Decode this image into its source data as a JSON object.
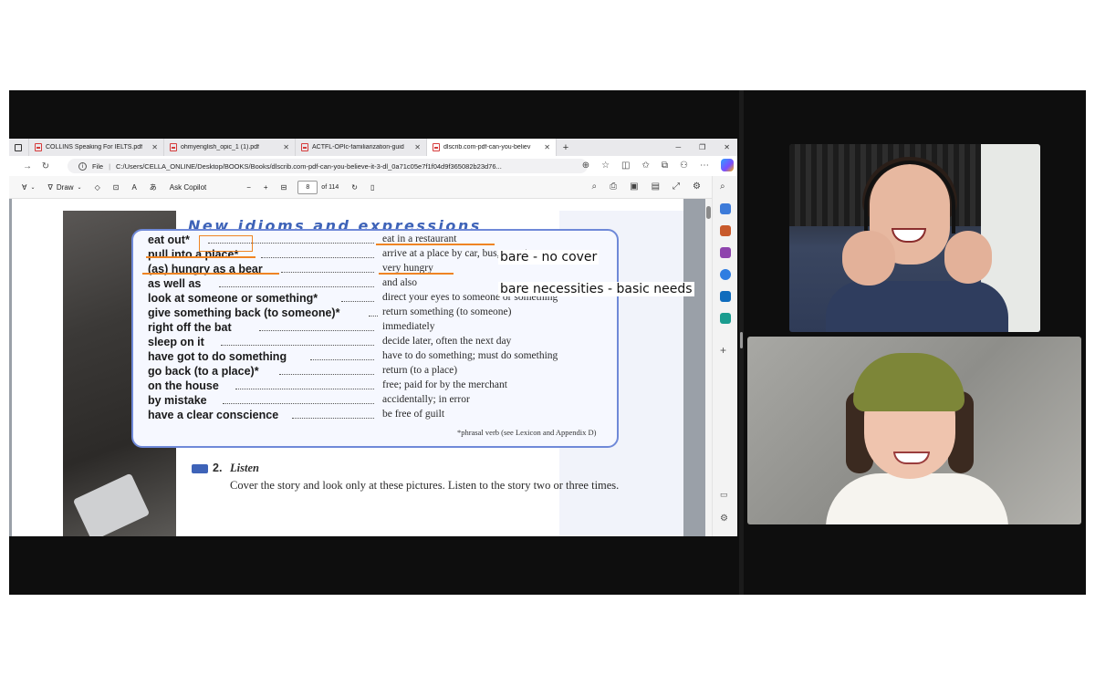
{
  "browser": {
    "tabs": [
      {
        "title": "COLLINS Speaking For IELTS.pdf",
        "active": false
      },
      {
        "title": "ohmyenglish_opic_1 (1).pdf",
        "active": false
      },
      {
        "title": "ACTFL-OPIc-familiarization-guid",
        "active": false
      },
      {
        "title": "dlscrib.com-pdf-can-you-believ",
        "active": true
      }
    ],
    "file_label": "File",
    "url": "C:/Users/CELLA_ONLINE/Desktop/BOOKS/Books/dlscrib.com-pdf-can-you-believe-it-3-dl_0a71c05e7f1f04d9f365082b23d76..."
  },
  "pdf_toolbar": {
    "draw_label": "Draw",
    "ask_copilot_label": "Ask Copilot",
    "page_number": "8",
    "page_total": "of 114"
  },
  "page": {
    "section_title": "New idioms and expressions",
    "idioms": [
      {
        "term": "eat out*",
        "definition": "eat in a restaurant"
      },
      {
        "term": "pull into a place*",
        "definition": "arrive at a place by car, bus, or train"
      },
      {
        "term": "(as) hungry as a bear",
        "definition": "very hungry"
      },
      {
        "term": "as well as",
        "definition": "and also"
      },
      {
        "term": "look at someone or something*",
        "definition": "direct your eyes to someone or something"
      },
      {
        "term": "give something back (to someone)*",
        "definition": "return something (to someone)"
      },
      {
        "term": "right off the bat",
        "definition": "immediately"
      },
      {
        "term": "sleep on it",
        "definition": "decide later, often the next day"
      },
      {
        "term": "have got to do something",
        "definition": "have to do something; must do something"
      },
      {
        "term": "go back (to a place)*",
        "definition": "return (to a place)"
      },
      {
        "term": "on the house",
        "definition": "free; paid for by the merchant"
      },
      {
        "term": "by mistake",
        "definition": "accidentally; in error"
      },
      {
        "term": "have a clear conscience",
        "definition": "be free of guilt"
      }
    ],
    "footnote": "*phrasal verb (see Lexicon and Appendix D)",
    "listen_number": "2.",
    "listen_title": "Listen",
    "listen_text": "Cover the story and look only at these pictures. Listen to the story two or three times."
  },
  "annotations": {
    "note1": "bare - no cover",
    "note2": "bare necessities - basic needs",
    "highlight_color": "#ef8423"
  }
}
